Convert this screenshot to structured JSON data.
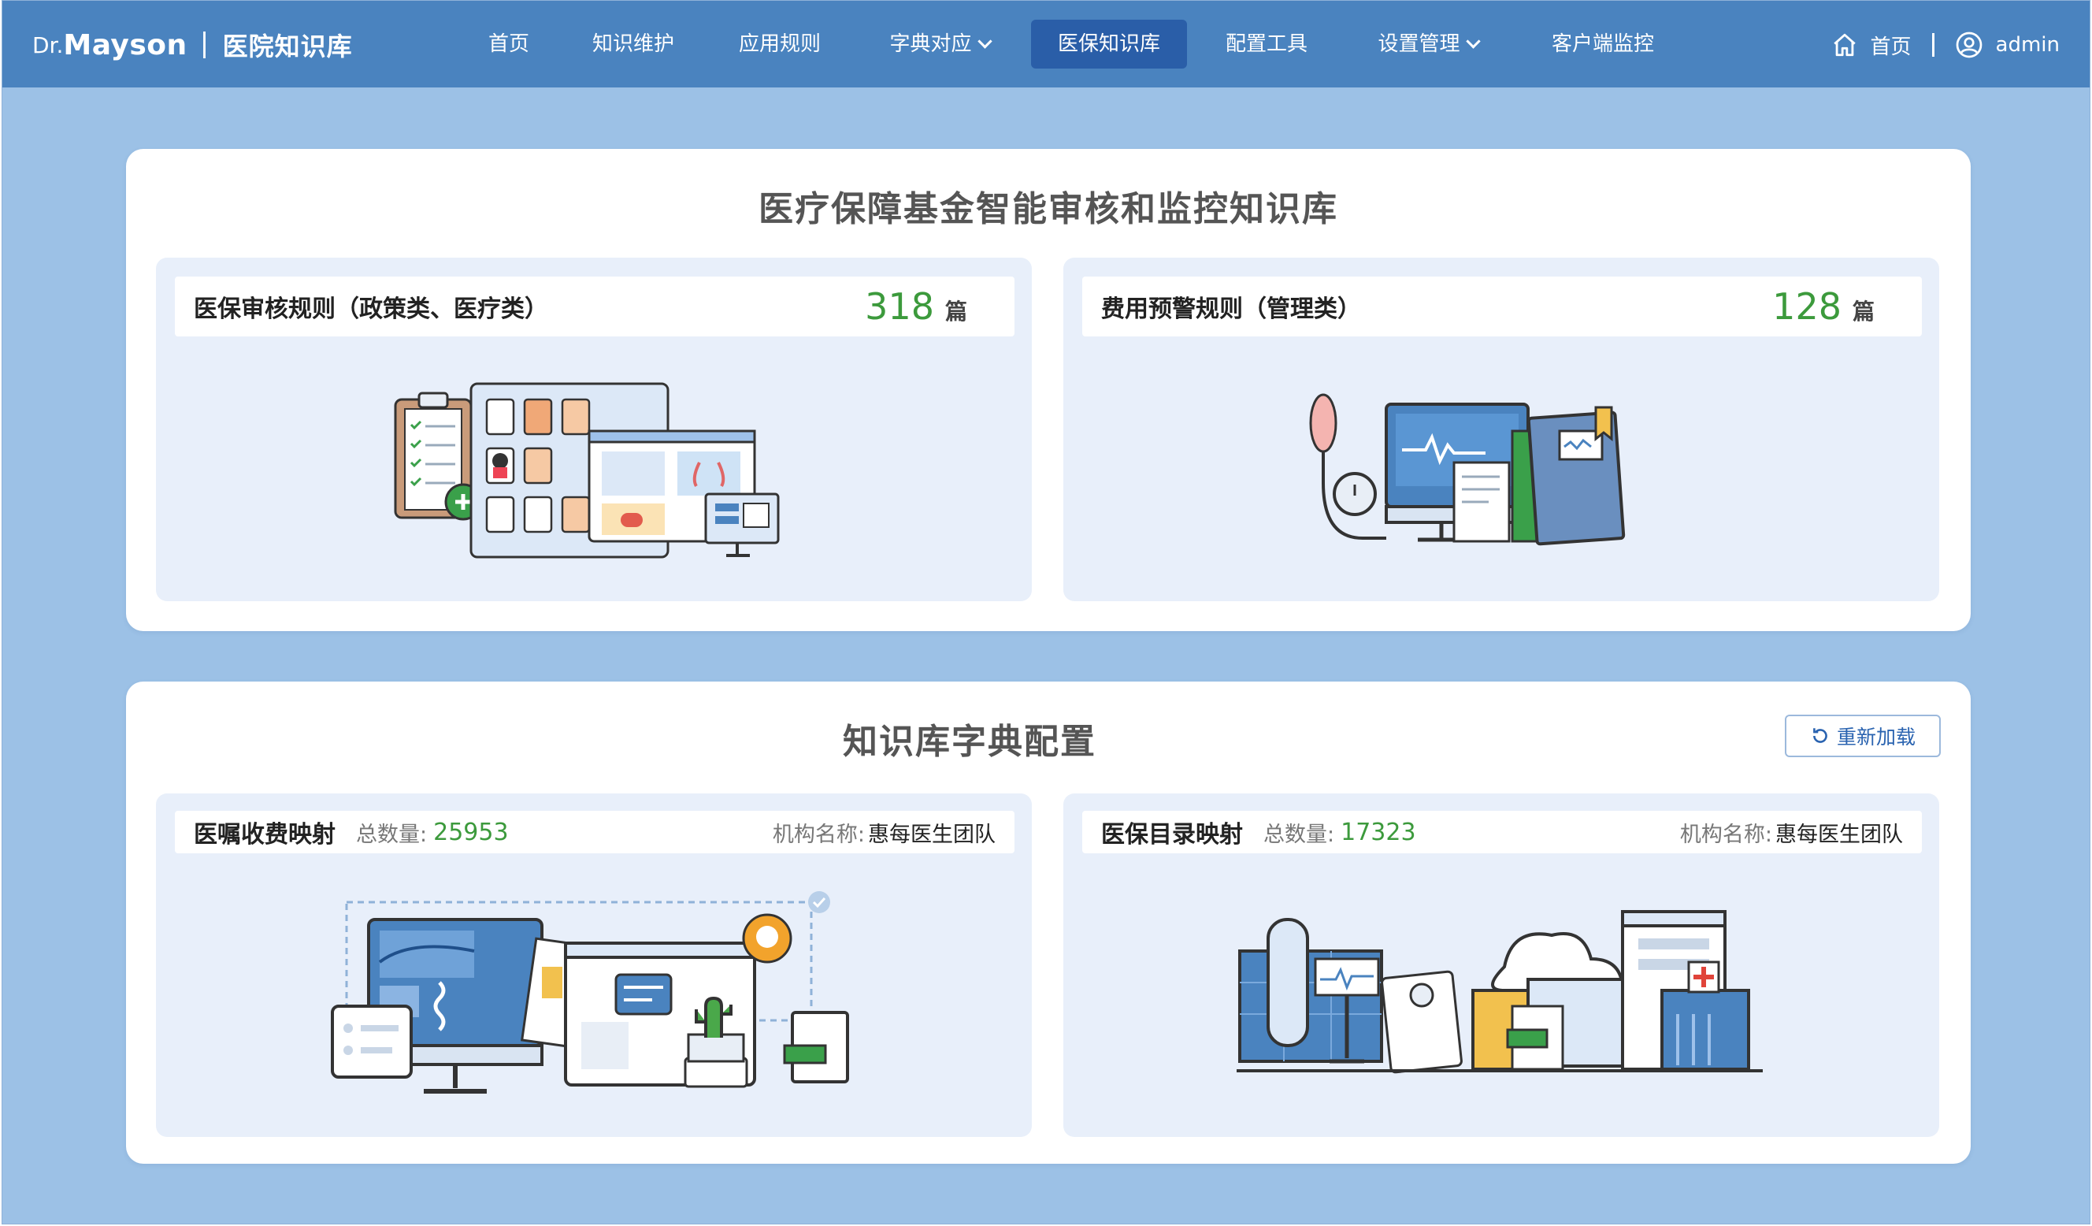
{
  "header": {
    "brand_dr": "Dr.",
    "brand_name": "Mayson",
    "brand_sub": "医院知识库",
    "nav": [
      {
        "label": "首页"
      },
      {
        "label": "知识维护"
      },
      {
        "label": "应用规则"
      },
      {
        "label": "字典对应",
        "has_dropdown": true
      },
      {
        "label": "医保知识库",
        "active": true
      },
      {
        "label": "配置工具"
      },
      {
        "label": "设置管理",
        "has_dropdown": true
      },
      {
        "label": "客户端监控"
      }
    ],
    "home_label": "首页",
    "user_label": "admin",
    "home_icon": "home-icon",
    "user_icon": "user-icon"
  },
  "section1": {
    "title": "医疗保障基金智能审核和监控知识库",
    "cards": [
      {
        "title": "医保审核规则（政策类、医疗类）",
        "count": "318",
        "unit": "篇"
      },
      {
        "title": "费用预警规则（管理类）",
        "count": "128",
        "unit": "篇"
      }
    ]
  },
  "section2": {
    "title": "知识库字典配置",
    "reload_label": "重新加载",
    "reload_icon": "refresh-icon",
    "cards": [
      {
        "title": "医嘱收费映射",
        "total_label": "总数量:",
        "total": "25953",
        "org_label": "机构名称:",
        "org": "惠每医生团队"
      },
      {
        "title": "医保目录映射",
        "total_label": "总数量:",
        "total": "17323",
        "org_label": "机构名称:",
        "org": "惠每医生团队"
      }
    ]
  },
  "colors": {
    "header_bg": "#4a83bf",
    "nav_active_bg": "#2a5ea8",
    "page_bg": "#9cc1e6",
    "card_bg": "#e8effa",
    "count_green": "#3c9a3c",
    "link_blue": "#2a63b0"
  }
}
